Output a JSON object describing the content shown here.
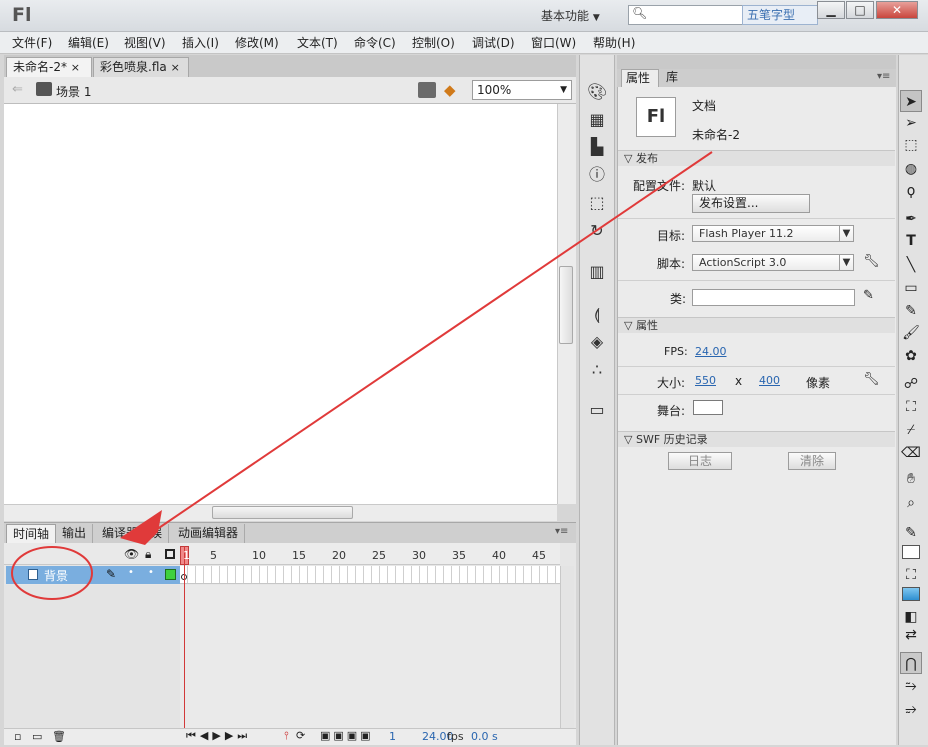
{
  "titlebar": {
    "logo": "Fl",
    "workspace": "基本功能",
    "search_placeholder": "",
    "watermark": "五笔字型",
    "minimize": "▁",
    "maximize": "□",
    "close": "✕"
  },
  "menu": [
    "文件(F)",
    "编辑(E)",
    "视图(V)",
    "插入(I)",
    "修改(M)",
    "文本(T)",
    "命令(C)",
    "控制(O)",
    "调试(D)",
    "窗口(W)",
    "帮助(H)"
  ],
  "doctabs": [
    {
      "label": "未命名-2*",
      "close": "×"
    },
    {
      "label": "彩色喷泉.fla",
      "close": "×"
    }
  ],
  "editbar": {
    "scene": "场景 1",
    "zoom": "100%"
  },
  "timeline": {
    "tabs": [
      "时间轴",
      "输出",
      "编译器错误",
      "动画编辑器"
    ],
    "ticks": [
      "1",
      "5",
      "10",
      "15",
      "20",
      "25",
      "30",
      "35",
      "40",
      "45"
    ],
    "layer": "背景",
    "frame": "1",
    "fps": "24.00",
    "fps_unit": "fps",
    "time": "0.0 s"
  },
  "properties": {
    "tabs": [
      "属性",
      "库"
    ],
    "doc_icon": "Fl",
    "doc_type": "文档",
    "doc_name": "未命名-2",
    "publish_section": "发布",
    "profile_label": "配置文件:",
    "profile_value": "默认",
    "publish_settings": "发布设置...",
    "target_label": "目标:",
    "target_value": "Flash Player 11.2",
    "script_label": "脚本:",
    "script_value": "ActionScript 3.0",
    "class_label": "类:",
    "props_section": "属性",
    "fps_label": "FPS:",
    "fps_value": "24.00",
    "size_label": "大小:",
    "width": "550",
    "x": "x",
    "height": "400",
    "unit": "像素",
    "stage_label": "舞台:",
    "history_section": "SWF 历史记录",
    "log_button": "日志",
    "clear_button": "清除"
  },
  "colors": {
    "layer_highlight": "#7aaedf",
    "playhead": "#d23a3a",
    "annotation_red": "#e03a3a"
  }
}
